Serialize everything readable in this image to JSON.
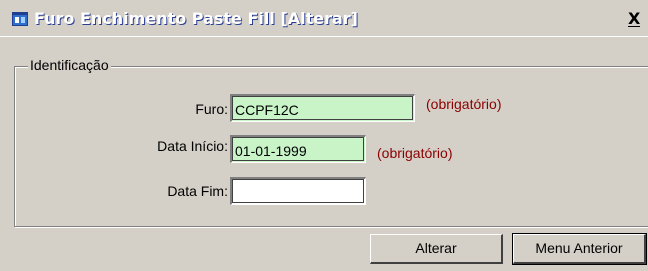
{
  "window": {
    "title": "Furo Enchimento Paste Fill [Alterar]",
    "close_glyph": "X",
    "icon": "app-window-icon"
  },
  "group": {
    "legend": "Identificação"
  },
  "fields": {
    "furo": {
      "label": "Furo:",
      "value": "CCPF12C",
      "required_note": "(obrigatório)"
    },
    "data_inicio": {
      "label": "Data Início:",
      "value": "01-01-1999",
      "required_note": "(obrigatório)"
    },
    "data_fim": {
      "label": "Data Fim:",
      "value": ""
    }
  },
  "buttons": {
    "alterar": "Alterar",
    "menu_anterior": "Menu Anterior"
  },
  "colors": {
    "dialog_face": "#d4d0c8",
    "required_field_bg": "#c8f4c8",
    "required_note_text": "#8b0000"
  }
}
